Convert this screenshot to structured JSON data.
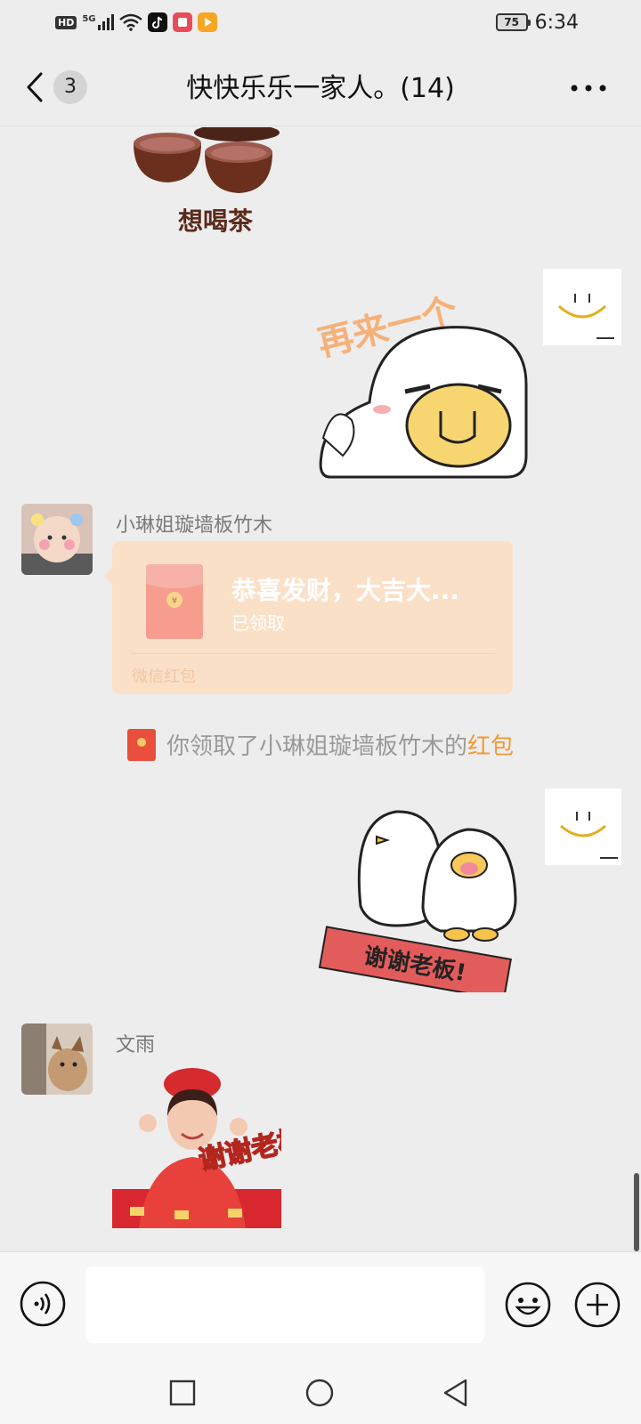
{
  "status_bar": {
    "hd": "HD",
    "network": "5G",
    "battery": "75",
    "time": "6:34"
  },
  "header": {
    "back_count": "3",
    "title": "快快乐乐一家人。(14)"
  },
  "messages": {
    "sticker1_text": "想喝茶",
    "sticker2_text": "再来一个",
    "sender1": "小琳姐璇墙板竹木",
    "red_packet": {
      "title": "恭喜发财，大吉大...",
      "status": "已领取",
      "footer": "微信红包"
    },
    "system_notice": {
      "prefix": "你领取了小琳姐璇墙板竹木的",
      "link": "红包"
    },
    "sticker3_text": "谢谢老板!",
    "sender2": "文雨",
    "sticker4_text": "谢谢老板"
  },
  "input": {
    "value": "",
    "placeholder": ""
  },
  "colors": {
    "background": "#ededed",
    "red_packet_bg": "#fbe0c8",
    "link_orange": "#f19a38"
  },
  "icons": [
    "back-arrow-icon",
    "more-icon",
    "voice-icon",
    "emoji-icon",
    "plus-icon",
    "nav-square-icon",
    "nav-circle-icon",
    "nav-triangle-icon"
  ]
}
